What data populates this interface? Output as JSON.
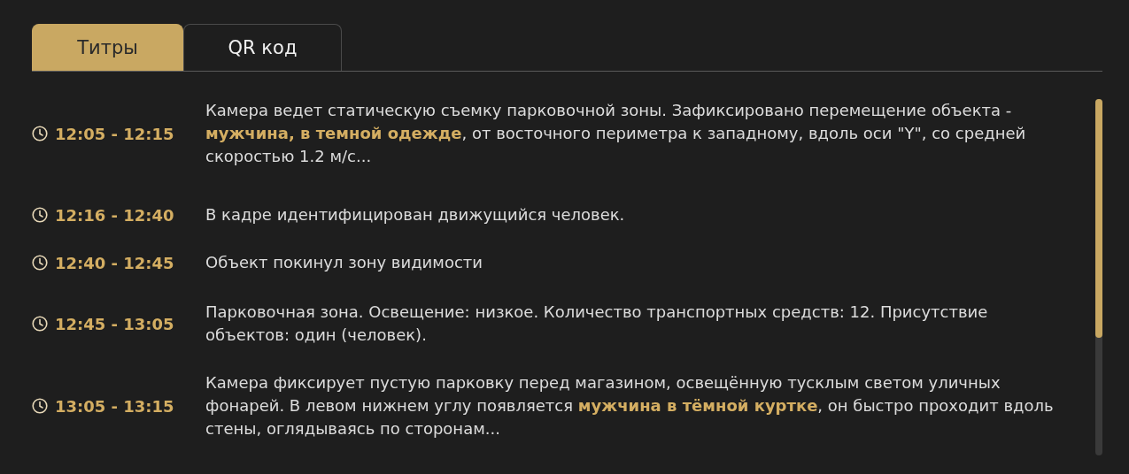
{
  "tabs": [
    {
      "label": "Титры",
      "selected": true
    },
    {
      "label": "QR код",
      "selected": false
    }
  ],
  "captions": [
    {
      "time": "12:05 - 12:15",
      "text": "Камера ведет статическую съемку парковочной зоны. Зафиксировано перемещение объекта - **мужчина, в темной одежде**, от восточного периметра к западному, вдоль оси \"Y\", со средней скоростью 1.2 м/с..."
    },
    {
      "time": "12:16 - 12:40",
      "text": "В кадре идентифицирован движущийся человек."
    },
    {
      "time": "12:40 - 12:45",
      "text": "Объект покинул зону видимости"
    },
    {
      "time": "12:45 - 13:05",
      "text": "Парковочная зона. Освещение: низкое. Количество транспортных средств: 12. Присутствие объектов: один (человек)."
    },
    {
      "time": "13:05 - 13:15",
      "text": "Камера фиксирует пустую парковку перед магазином, освещённую тусклым светом уличных фонарей. В левом нижнем углу появляется **мужчина в тёмной куртке**, он быстро проходит вдоль стены, оглядываясь по сторонам..."
    }
  ]
}
